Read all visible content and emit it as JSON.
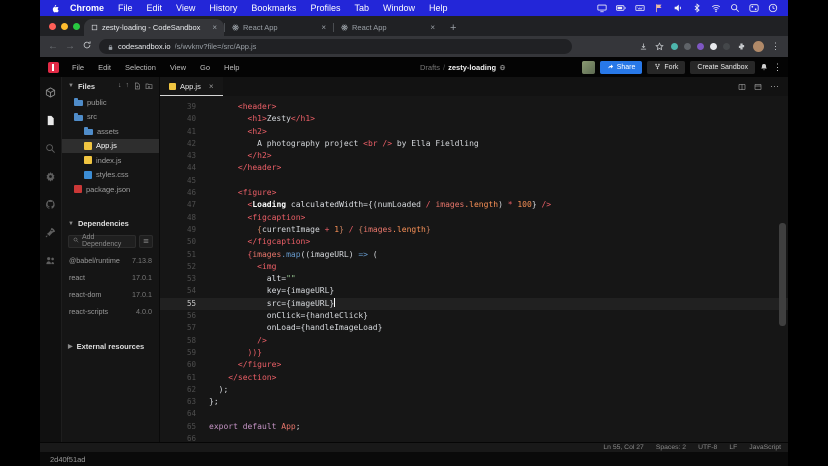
{
  "menubar": {
    "items": [
      "Chrome",
      "File",
      "Edit",
      "View",
      "History",
      "Bookmarks",
      "Profiles",
      "Tab",
      "Window",
      "Help"
    ],
    "status_icons": [
      "display",
      "battery",
      "keyboard",
      "flag",
      "volume",
      "bluetooth",
      "wifi",
      "search",
      "control",
      "clock"
    ]
  },
  "browser": {
    "tabs": [
      {
        "title": "zesty-loading - CodeSandbox",
        "favicon": "codesandbox",
        "active": true
      },
      {
        "title": "React App",
        "favicon": "react",
        "active": false
      },
      {
        "title": "React App",
        "favicon": "react",
        "active": false
      }
    ],
    "new_tab_label": "+",
    "toolbar": {
      "back_label": "←",
      "forward_label": "→",
      "url_domain": "codesandbox.io",
      "url_path": "/s/wvknv?file=/src/App.js",
      "extensions": [
        {
          "name": "extension-teal",
          "color": "#4db6ac"
        },
        {
          "name": "extension-gray",
          "color": "#5f6368"
        },
        {
          "name": "extension-purple",
          "color": "#7e57c2"
        },
        {
          "name": "extension-white",
          "color": "#e8eaed"
        },
        {
          "name": "extension-dim",
          "color": "#44474a"
        }
      ]
    }
  },
  "csb": {
    "menu": [
      "File",
      "Edit",
      "Selection",
      "View",
      "Go",
      "Help"
    ],
    "breadcrumb": {
      "folder": "Drafts",
      "separator": "/",
      "name": "zesty-loading"
    },
    "buttons": {
      "share": "Share",
      "fork": "Fork",
      "create": "Create Sandbox"
    },
    "rail": [
      "overview",
      "explorer",
      "search",
      "settings",
      "github",
      "deployment",
      "live"
    ],
    "explorer": {
      "files_label": "Files",
      "tree": [
        {
          "name": "public",
          "icon": "folder",
          "depth": 1,
          "selected": false
        },
        {
          "name": "src",
          "icon": "folder",
          "depth": 1,
          "selected": false
        },
        {
          "name": "assets",
          "icon": "folder",
          "depth": 2,
          "selected": false
        },
        {
          "name": "App.js",
          "icon": "js",
          "depth": 2,
          "selected": true
        },
        {
          "name": "index.js",
          "icon": "js",
          "depth": 2,
          "selected": false
        },
        {
          "name": "styles.css",
          "icon": "css",
          "depth": 2,
          "selected": false
        },
        {
          "name": "package.json",
          "icon": "npm",
          "depth": 1,
          "selected": false
        }
      ],
      "dependencies_label": "Dependencies",
      "add_dependency_label": "Add Dependency",
      "dependencies": [
        {
          "name": "@babel/runtime",
          "version": "7.13.8"
        },
        {
          "name": "react",
          "version": "17.0.1"
        },
        {
          "name": "react-dom",
          "version": "17.0.1"
        },
        {
          "name": "react-scripts",
          "version": "4.0.0"
        }
      ],
      "external_label": "External resources"
    },
    "editor": {
      "tab": "App.js",
      "current_line": 55,
      "lines": [
        {
          "n": 39,
          "t": [
            [
              "p",
              "      "
            ],
            [
              "t",
              "<header>"
            ]
          ]
        },
        {
          "n": 40,
          "t": [
            [
              "p",
              "        "
            ],
            [
              "t",
              "<h1>"
            ],
            [
              "p",
              "Zesty"
            ],
            [
              "t",
              "</h1>"
            ]
          ]
        },
        {
          "n": 41,
          "t": [
            [
              "p",
              "        "
            ],
            [
              "t",
              "<h2>"
            ]
          ]
        },
        {
          "n": 42,
          "t": [
            [
              "p",
              "          A photography project "
            ],
            [
              "t",
              "<br />"
            ],
            [
              "p",
              " by Ella Fieldling"
            ]
          ]
        },
        {
          "n": 43,
          "t": [
            [
              "p",
              "        "
            ],
            [
              "t",
              "</h2>"
            ]
          ]
        },
        {
          "n": 44,
          "t": [
            [
              "p",
              "      "
            ],
            [
              "t",
              "</header>"
            ]
          ]
        },
        {
          "n": 45,
          "t": []
        },
        {
          "n": 46,
          "t": [
            [
              "p",
              "      "
            ],
            [
              "t",
              "<figure>"
            ]
          ]
        },
        {
          "n": 47,
          "t": [
            [
              "p",
              "        "
            ],
            [
              "t",
              "<"
            ],
            [
              "c",
              "Loading"
            ],
            [
              "p",
              " "
            ],
            [
              "a",
              "calculatedWidth"
            ],
            [
              "p",
              "={("
            ],
            [
              "p",
              "numLoaded "
            ],
            [
              "o",
              "/"
            ],
            [
              "p",
              " "
            ],
            [
              "v",
              "images"
            ],
            [
              "n",
              ".length"
            ],
            [
              "p",
              ") "
            ],
            [
              "o",
              "*"
            ],
            [
              "p",
              " "
            ],
            [
              "n",
              "100"
            ],
            [
              "p",
              "} "
            ],
            [
              "t",
              "/>"
            ]
          ]
        },
        {
          "n": 48,
          "t": [
            [
              "p",
              "        "
            ],
            [
              "t",
              "<figcaption>"
            ]
          ]
        },
        {
          "n": 49,
          "t": [
            [
              "p",
              "          "
            ],
            [
              "jx",
              "{"
            ],
            [
              "p",
              "currentImage "
            ],
            [
              "o",
              "+"
            ],
            [
              "p",
              " "
            ],
            [
              "n",
              "1"
            ],
            [
              "jx",
              "}"
            ],
            [
              "p",
              " "
            ],
            [
              "o",
              "/"
            ],
            [
              "p",
              " "
            ],
            [
              "jx",
              "{"
            ],
            [
              "v",
              "images"
            ],
            [
              "n",
              ".length"
            ],
            [
              "jx",
              "}"
            ]
          ]
        },
        {
          "n": 50,
          "t": [
            [
              "p",
              "        "
            ],
            [
              "t",
              "</figcaption>"
            ]
          ]
        },
        {
          "n": 51,
          "t": [
            [
              "p",
              "        "
            ],
            [
              "o",
              "{"
            ],
            [
              "v",
              "images"
            ],
            [
              "m",
              ".map"
            ],
            [
              "p",
              "(("
            ],
            [
              "p",
              "imageURL"
            ],
            [
              "p",
              ") "
            ],
            [
              "m",
              "=>"
            ],
            [
              "p",
              " ("
            ]
          ]
        },
        {
          "n": 52,
          "t": [
            [
              "p",
              "          "
            ],
            [
              "t",
              "<img"
            ]
          ]
        },
        {
          "n": 53,
          "t": [
            [
              "p",
              "            "
            ],
            [
              "a",
              "alt"
            ],
            [
              "p",
              "="
            ],
            [
              "s",
              "\"\""
            ]
          ]
        },
        {
          "n": 54,
          "t": [
            [
              "p",
              "            "
            ],
            [
              "a",
              "key"
            ],
            [
              "p",
              "={"
            ],
            [
              "p",
              "imageURL"
            ],
            [
              "p",
              "}"
            ]
          ]
        },
        {
          "n": 55,
          "t": [
            [
              "p",
              "            "
            ],
            [
              "a",
              "src"
            ],
            [
              "p",
              "={"
            ],
            [
              "p",
              "imageURL"
            ],
            [
              "p",
              "}"
            ]
          ],
          "caret": true
        },
        {
          "n": 56,
          "t": [
            [
              "p",
              "            "
            ],
            [
              "a",
              "onClick"
            ],
            [
              "p",
              "={"
            ],
            [
              "p",
              "handleClick"
            ],
            [
              "p",
              "}"
            ]
          ]
        },
        {
          "n": 57,
          "t": [
            [
              "p",
              "            "
            ],
            [
              "a",
              "onLoad"
            ],
            [
              "p",
              "={"
            ],
            [
              "p",
              "handleImageLoad"
            ],
            [
              "p",
              "}"
            ]
          ]
        },
        {
          "n": 58,
          "t": [
            [
              "p",
              "          "
            ],
            [
              "t",
              "/>"
            ]
          ]
        },
        {
          "n": 59,
          "t": [
            [
              "p",
              "        "
            ],
            [
              "o",
              "))}"
            ]
          ]
        },
        {
          "n": 60,
          "t": [
            [
              "p",
              "      "
            ],
            [
              "t",
              "</figure>"
            ]
          ]
        },
        {
          "n": 61,
          "t": [
            [
              "p",
              "    "
            ],
            [
              "t",
              "</section>"
            ]
          ]
        },
        {
          "n": 62,
          "t": [
            [
              "p",
              "  );"
            ]
          ]
        },
        {
          "n": 63,
          "t": [
            [
              "p",
              "};"
            ]
          ]
        },
        {
          "n": 64,
          "t": []
        },
        {
          "n": 65,
          "t": [
            [
              "k",
              "export"
            ],
            [
              "p",
              " "
            ],
            [
              "k",
              "default"
            ],
            [
              "p",
              " "
            ],
            [
              "v",
              "App"
            ],
            [
              "p",
              ";"
            ]
          ]
        },
        {
          "n": 66,
          "t": []
        }
      ]
    },
    "statusbar": [
      "Ln 55, Col 27",
      "Spaces: 2",
      "UTF-8",
      "LF",
      "JavaScript"
    ]
  },
  "watermark": "2d40f51ad",
  "colors": {
    "menubar_blue": "#2326d8",
    "accent_blue": "#2878e8",
    "tag_red": "#ec5f67",
    "number_orange": "#f99157",
    "keyword_purple": "#c594c5"
  }
}
